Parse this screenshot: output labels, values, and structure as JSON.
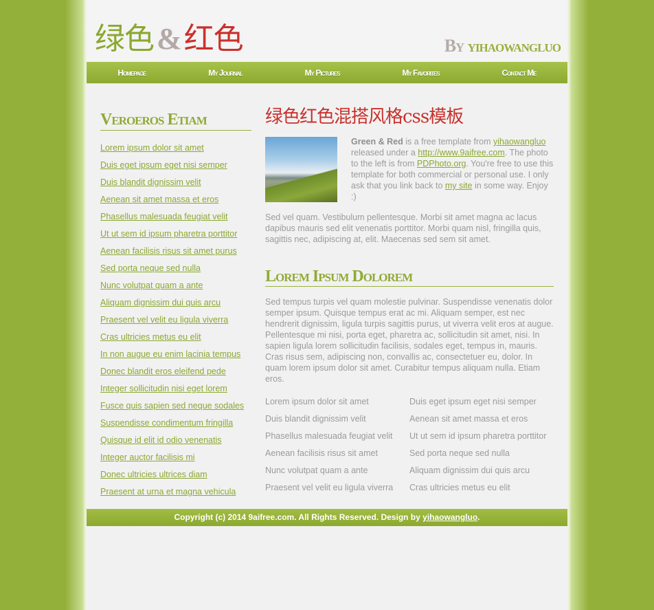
{
  "header": {
    "logo_green": "绿色",
    "logo_amp": "&",
    "logo_red": "红色",
    "byline_by": "By",
    "byline_name": "yihaowangluo"
  },
  "nav": [
    "Homepage",
    "My Journal",
    "My Pictures",
    "My Favorites",
    "Contact Me"
  ],
  "sidebar": {
    "title": "Veroeros Etiam",
    "links": [
      "Lorem ipsum dolor sit amet",
      "Duis eget ipsum eget nisi semper",
      "Duis blandit dignissim velit",
      "Aenean sit amet massa et eros",
      "Phasellus malesuada feugiat velit",
      "Ut ut sem id ipsum pharetra porttitor",
      "Aenean facilisis risus sit amet purus",
      "Sed porta neque sed nulla",
      "Nunc volutpat quam a ante",
      "Aliquam dignissim dui quis arcu",
      "Praesent vel velit eu ligula viverra",
      "Cras ultricies metus eu elit",
      "In non augue eu enim lacinia tempus",
      "Donec blandit eros eleifend pede",
      "Integer sollicitudin nisi eget lorem",
      "Fusce quis sapien sed neque sodales",
      "Suspendisse condimentum fringilla",
      "Quisque id elit id odio venenatis",
      "Integer auctor facilisis mi",
      "Donec ultricies ultrices diam",
      "Praesent at urna et magna vehicula"
    ]
  },
  "main": {
    "title": "绿色红色混搭风格css模板",
    "intro": {
      "bold": "Green & Red",
      "t1": " is a free template from ",
      "link1": "yihaowangluo",
      "t2": " released under a ",
      "link2": "http://www.9aifree.com",
      "t3": ". The photo to the left is from ",
      "link3": "PDPhoto.org",
      "t4": ". You're free to use this template for both commercial or personal use. I only ask that you link back to ",
      "link4": "my site",
      "t5": " in some way. Enjoy :)"
    },
    "para1": "Sed vel quam. Vestibulum pellentesque. Morbi sit amet magna ac lacus dapibus mauris sed elit venenatis porttitor. Morbi quam nisl, fringilla quis, sagittis nec, adipiscing at, elit. Maecenas sed sem sit amet.",
    "section_title": "Lorem Ipsum Dolorem",
    "para2": "Sed tempus turpis vel quam molestie pulvinar. Suspendisse venenatis dolor semper ipsum. Quisque tempus erat ac mi. Aliquam semper, est nec hendrerit dignissim, ligula turpis sagittis purus, ut viverra velit eros at augue. Pellentesque mi nisi, porta eget, pharetra ac, sollicitudin sit amet, nisi. In sapien ligula lorem sollicitudin facilisis, sodales eget, tempus in, mauris. Cras risus sem, adipiscing non, convallis ac, consectetuer eu, dolor. In quam lorem ipsum dolor sit amet. Curabitur tempus aliquam nulla. Etiam eros.",
    "col_left": [
      "Lorem ipsum dolor sit amet",
      "Duis blandit dignissim velit",
      "Phasellus malesuada feugiat velit",
      "Aenean facilisis risus sit amet",
      "Nunc volutpat quam a ante",
      "Praesent vel velit eu ligula viverra"
    ],
    "col_right": [
      "Duis eget ipsum eget nisi semper",
      "Aenean sit amet massa et eros",
      "Ut ut sem id ipsum pharetra porttitor",
      "Sed porta neque sed nulla",
      "Aliquam dignissim dui quis arcu",
      "Cras ultricies metus eu elit"
    ]
  },
  "footer": {
    "text": "Copyright (c) 2014 9aifree.com. All Rights Reserved. Design by ",
    "link": "yihaowangluo",
    "end": "."
  },
  "colors": {
    "green": "#8aa832",
    "red": "#c8312c",
    "gray_text": "#9b9b9b",
    "page_bg": "#f2f1f1"
  }
}
